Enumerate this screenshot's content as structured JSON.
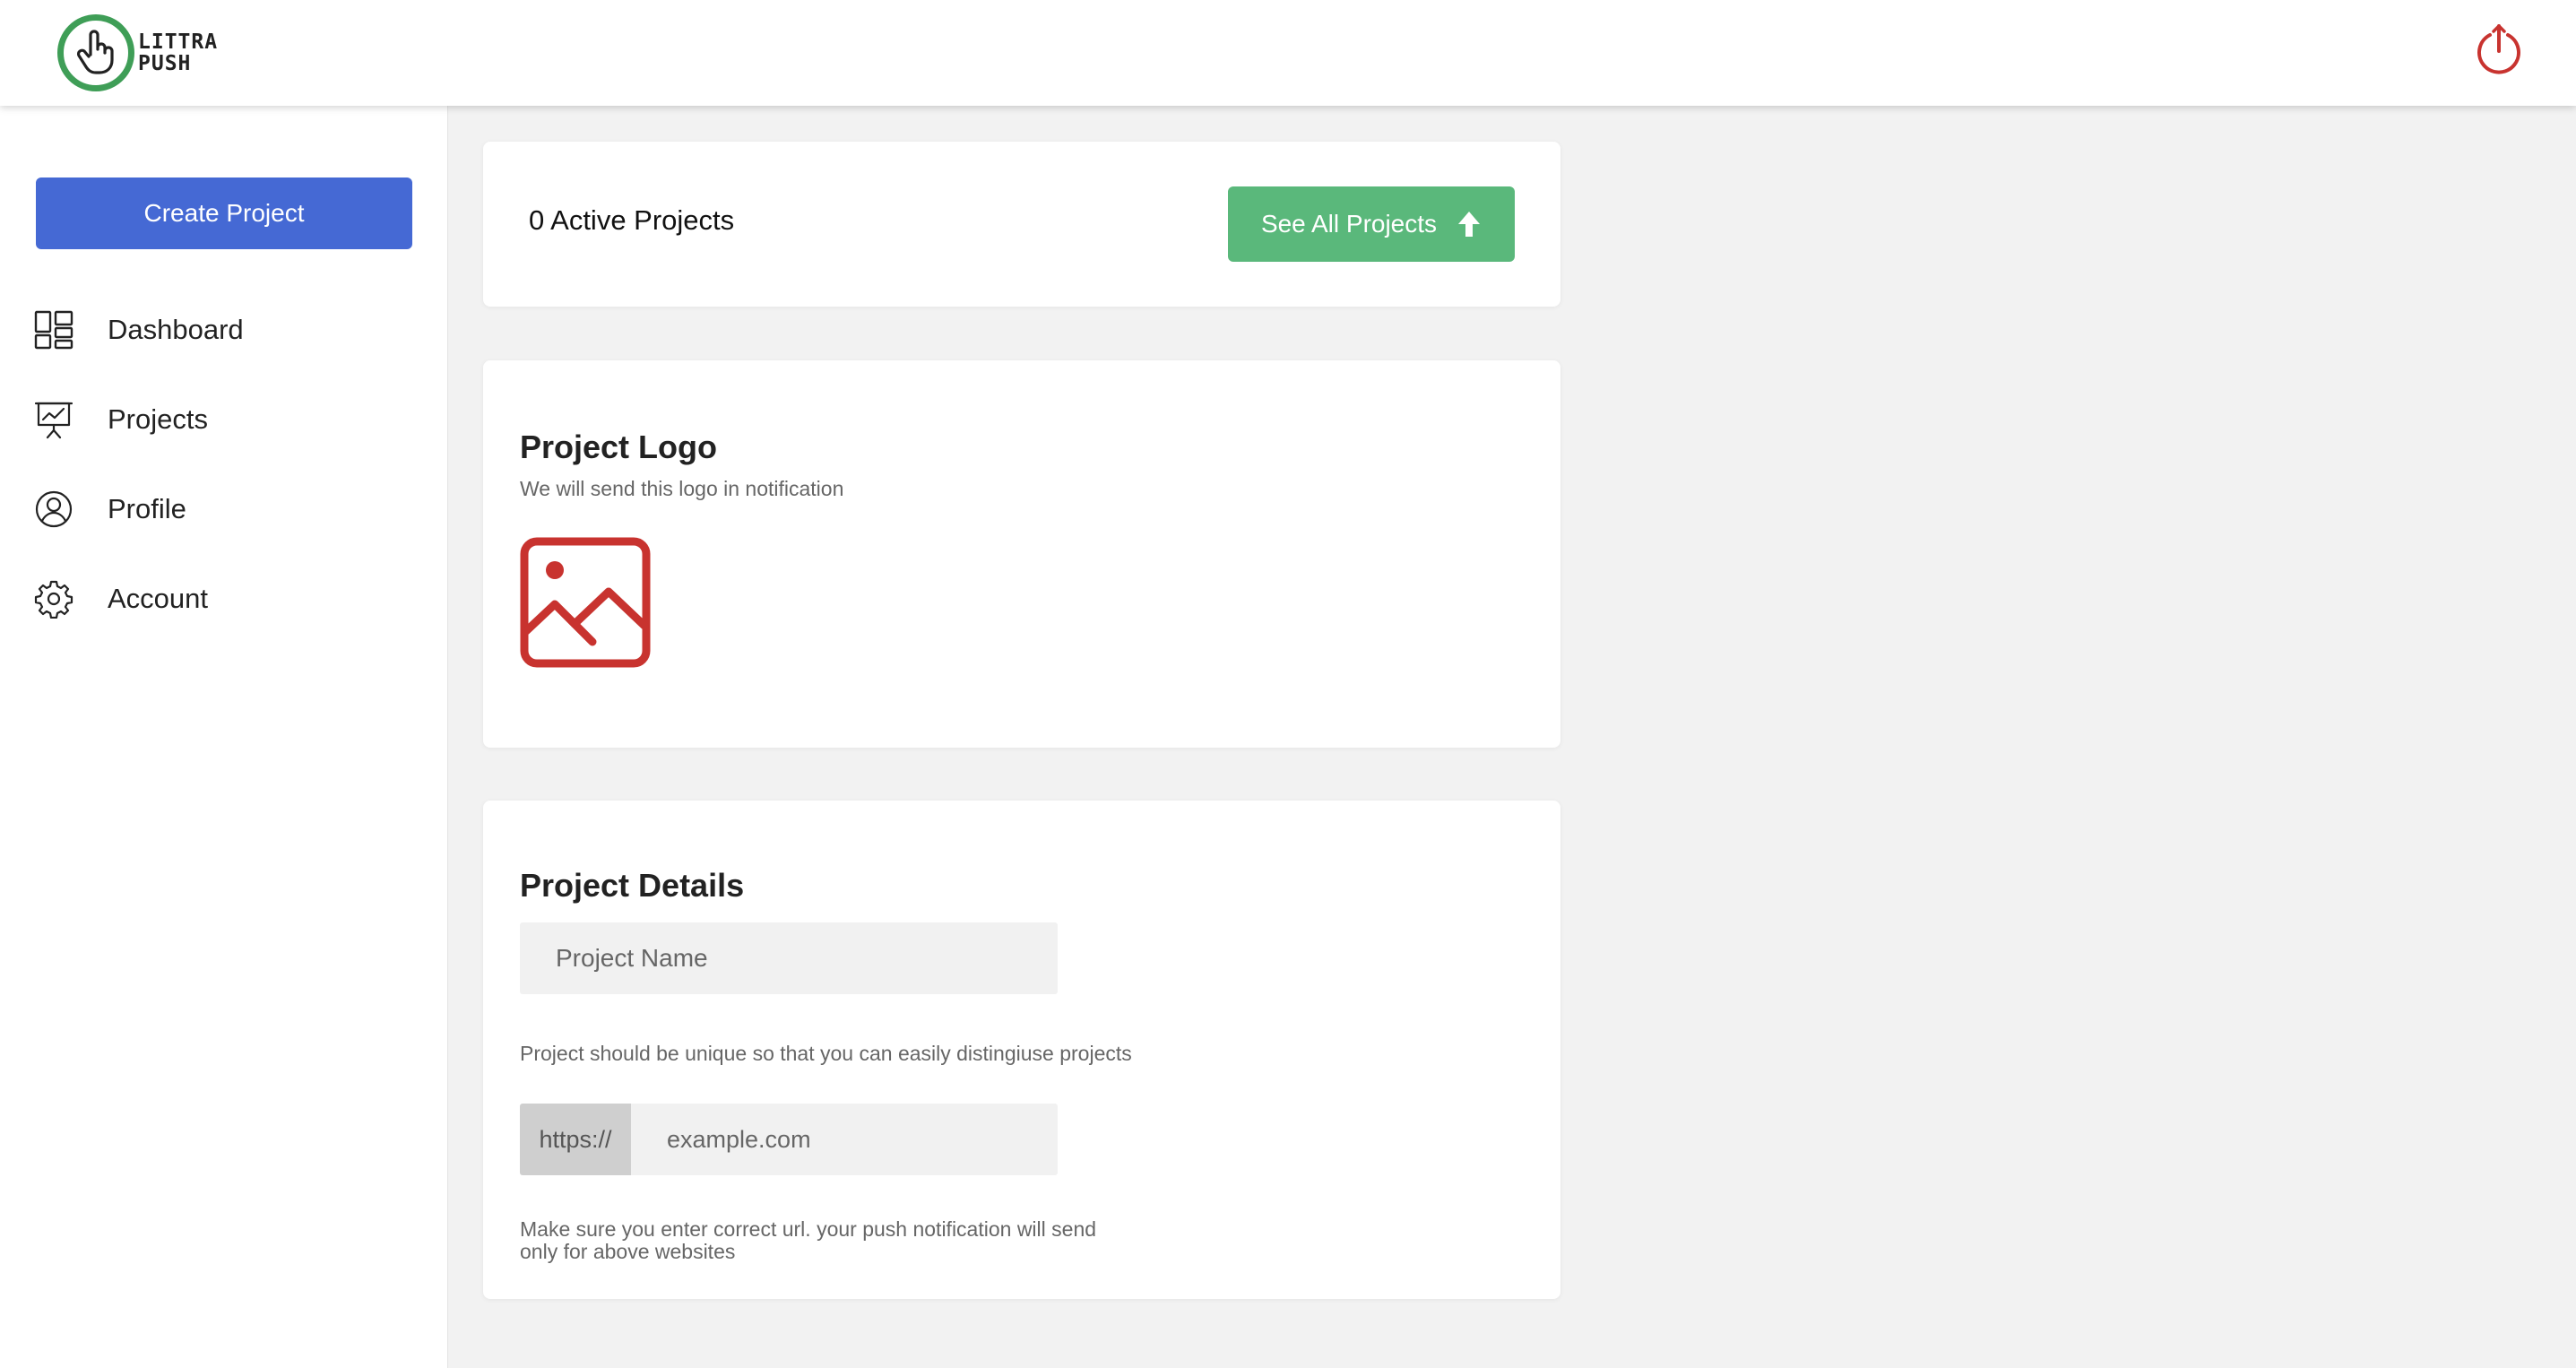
{
  "brand": {
    "name_line1": "LITTRA",
    "name_line2": "PUSH",
    "logo_icon": "pointing-hand-icon",
    "accent_color": "#3f9e57"
  },
  "header": {
    "power_icon": "power-icon",
    "power_color": "#c8332f"
  },
  "sidebar": {
    "create_button_label": "Create Project",
    "create_button_color": "#4569d4",
    "items": [
      {
        "label": "Dashboard",
        "icon": "dashboard-icon"
      },
      {
        "label": "Projects",
        "icon": "presentation-icon"
      },
      {
        "label": "Profile",
        "icon": "user-circle-icon"
      },
      {
        "label": "Account",
        "icon": "gear-icon"
      }
    ]
  },
  "summary": {
    "active_projects_text": "0 Active Projects",
    "see_all_label": "See All Projects",
    "see_all_icon": "arrow-up-icon",
    "see_all_color": "#5ab87b"
  },
  "project_logo": {
    "title": "Project Logo",
    "subtitle": "We will send this logo in notification",
    "placeholder_icon": "image-icon",
    "placeholder_color": "#c8332f"
  },
  "project_details": {
    "title": "Project Details",
    "name_placeholder": "Project Name",
    "name_hint": "Project should be unique so that you can easily distingiuse projects",
    "url_prefix": "https://",
    "url_placeholder": "example.com",
    "url_hint_line1": "Make sure you enter correct url. your push notification will send",
    "url_hint_line2": "only for above websites"
  }
}
